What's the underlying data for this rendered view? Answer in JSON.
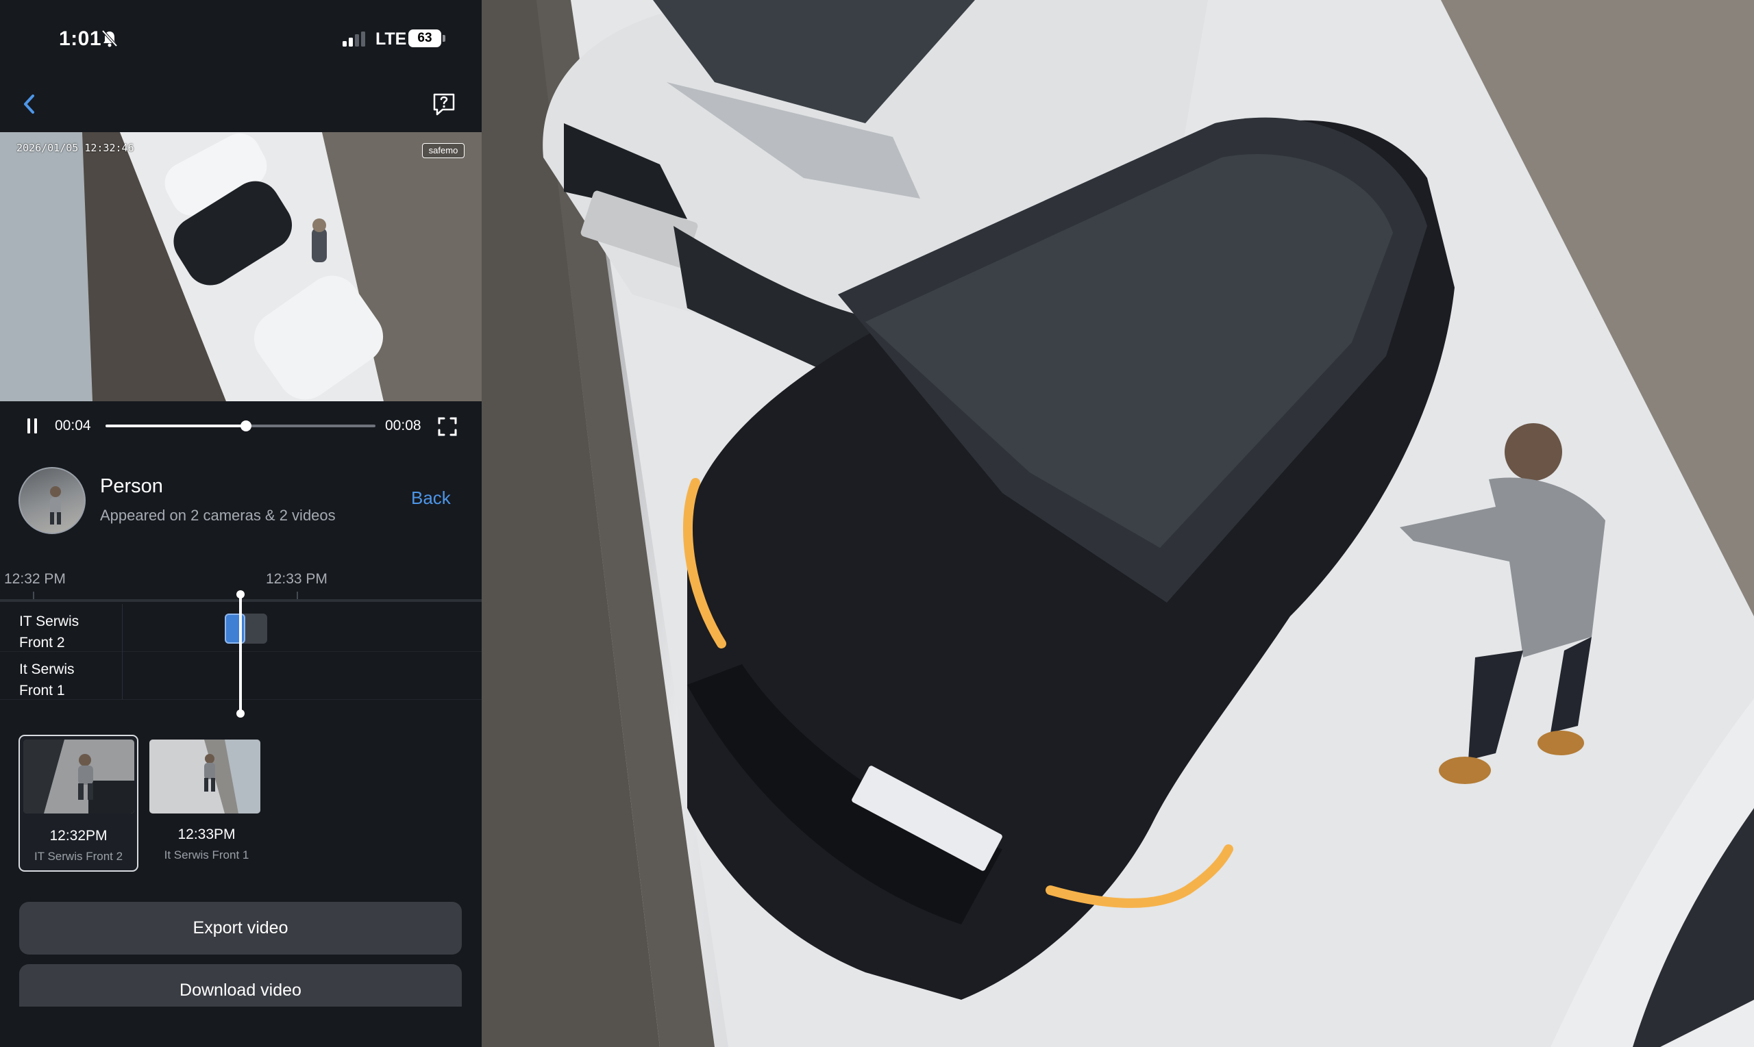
{
  "status_bar": {
    "time": "1:01",
    "network": "LTE",
    "battery": "63"
  },
  "video": {
    "osd_timestamp": "2026/01/05 12:32:46",
    "osd_logo": "safemo",
    "elapsed": "00:04",
    "duration": "00:08",
    "progress_fraction": 0.52
  },
  "detection": {
    "title": "Person",
    "subtitle": "Appeared on 2 cameras & 2 videos",
    "back_label": "Back"
  },
  "timeline": {
    "ticks": [
      "12:32 PM",
      "12:33 PM"
    ],
    "cameras": [
      {
        "label_line1": "IT Serwis",
        "label_line2": "Front 2"
      },
      {
        "label_line1": "It Serwis",
        "label_line2": "Front 1"
      }
    ]
  },
  "thumbnails": [
    {
      "time": "12:32PM",
      "camera": "IT Serwis Front 2",
      "selected": true
    },
    {
      "time": "12:33PM",
      "camera": "It Serwis Front 1",
      "selected": false
    }
  ],
  "buttons": {
    "export": "Export video",
    "download": "Download video"
  },
  "colors": {
    "accent": "#4d96e8",
    "panel_background": "#16191e",
    "button_background": "#3a3d43"
  }
}
